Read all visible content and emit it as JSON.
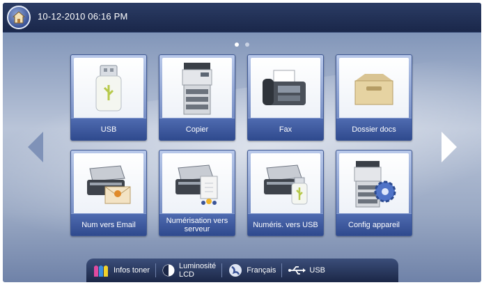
{
  "status": {
    "datetime": "10-12-2010 06:16 PM"
  },
  "page_indicator": {
    "pages": 2,
    "current": 1
  },
  "tiles": [
    {
      "label": "USB",
      "icon": "usb-drive-icon"
    },
    {
      "label": "Copier",
      "icon": "copier-icon"
    },
    {
      "label": "Fax",
      "icon": "fax-icon"
    },
    {
      "label": "Dossier docs",
      "icon": "document-box-icon"
    },
    {
      "label": "Num vers Email",
      "icon": "scan-to-email-icon"
    },
    {
      "label": "Numérisation vers serveur",
      "icon": "scan-to-server-icon"
    },
    {
      "label": "Numéris. vers USB",
      "icon": "scan-to-usb-icon"
    },
    {
      "label": "Config appareil",
      "icon": "machine-setup-icon"
    }
  ],
  "bottombar": {
    "toner": "Infos toner",
    "brightness_line1": "Luminosité",
    "brightness_line2": "LCD",
    "language": "Français",
    "usb": "USB"
  },
  "colors": {
    "accent": "#3b5497",
    "topbar": "#1a274a"
  }
}
